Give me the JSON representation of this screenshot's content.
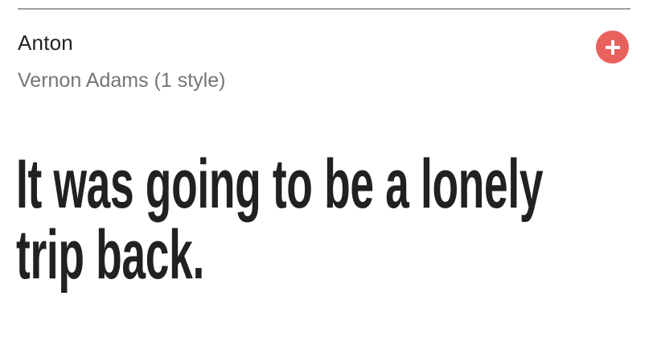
{
  "font_card": {
    "name": "Anton",
    "meta": "Vernon Adams (1 style)",
    "preview": "It was going to be a lonely trip back.",
    "add_button": {
      "icon": "plus-icon",
      "color": "#e8615d"
    }
  }
}
